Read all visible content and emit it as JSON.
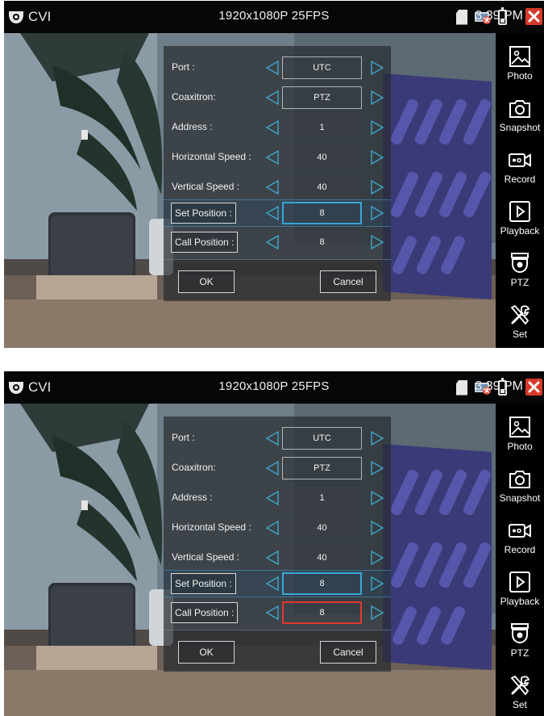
{
  "screens": [
    {
      "app_name": "CVI",
      "resolution": "1920x1080P 25FPS",
      "clock": "3:39 PM",
      "sidebar": [
        "Photo",
        "Snapshot",
        "Record",
        "Playback",
        "PTZ",
        "Set"
      ],
      "dialog": {
        "port_label": "Port :",
        "port_value": "UTC",
        "coaxitron_label": "Coaxitron:",
        "coaxitron_value": "PTZ",
        "address_label": "Address :",
        "address_value": "1",
        "hspeed_label": "Horizontal Speed :",
        "hspeed_value": "40",
        "vspeed_label": "Vertical Speed :",
        "vspeed_value": "40",
        "setpos_label": "Set Position :",
        "setpos_value": "8",
        "callpos_label": "Call Position :",
        "callpos_value": "8",
        "ok_label": "OK",
        "cancel_label": "Cancel"
      }
    },
    {
      "app_name": "CVI",
      "resolution": "1920x1080P 25FPS",
      "clock": "3:39 PM",
      "sidebar": [
        "Photo",
        "Snapshot",
        "Record",
        "Playback",
        "PTZ",
        "Set"
      ],
      "dialog": {
        "port_label": "Port :",
        "port_value": "UTC",
        "coaxitron_label": "Coaxitron:",
        "coaxitron_value": "PTZ",
        "address_label": "Address :",
        "address_value": "1",
        "hspeed_label": "Horizontal Speed :",
        "hspeed_value": "40",
        "vspeed_label": "Vertical Speed :",
        "vspeed_value": "40",
        "setpos_label": "Set Position :",
        "setpos_value": "8",
        "callpos_label": "Call Position :",
        "callpos_value": "8",
        "ok_label": "OK",
        "cancel_label": "Cancel"
      }
    }
  ],
  "icons": {
    "app": "cctv-camera-icon",
    "sd": "sd-card-icon",
    "network": "network-error-icon",
    "battery": "battery-icon",
    "close": "close-icon",
    "photo": "photo-icon",
    "snapshot": "camera-icon",
    "record": "video-record-icon",
    "playback": "play-icon",
    "ptz": "dome-camera-icon",
    "set": "tools-icon",
    "arrow_left": "arrow-left-icon",
    "arrow_right": "arrow-right-icon"
  },
  "colors": {
    "selected_blue": "#35a7d8",
    "selected_red": "#e0382e",
    "close_red": "#d63a2b",
    "arrow_teal": "#3fa6c8"
  }
}
